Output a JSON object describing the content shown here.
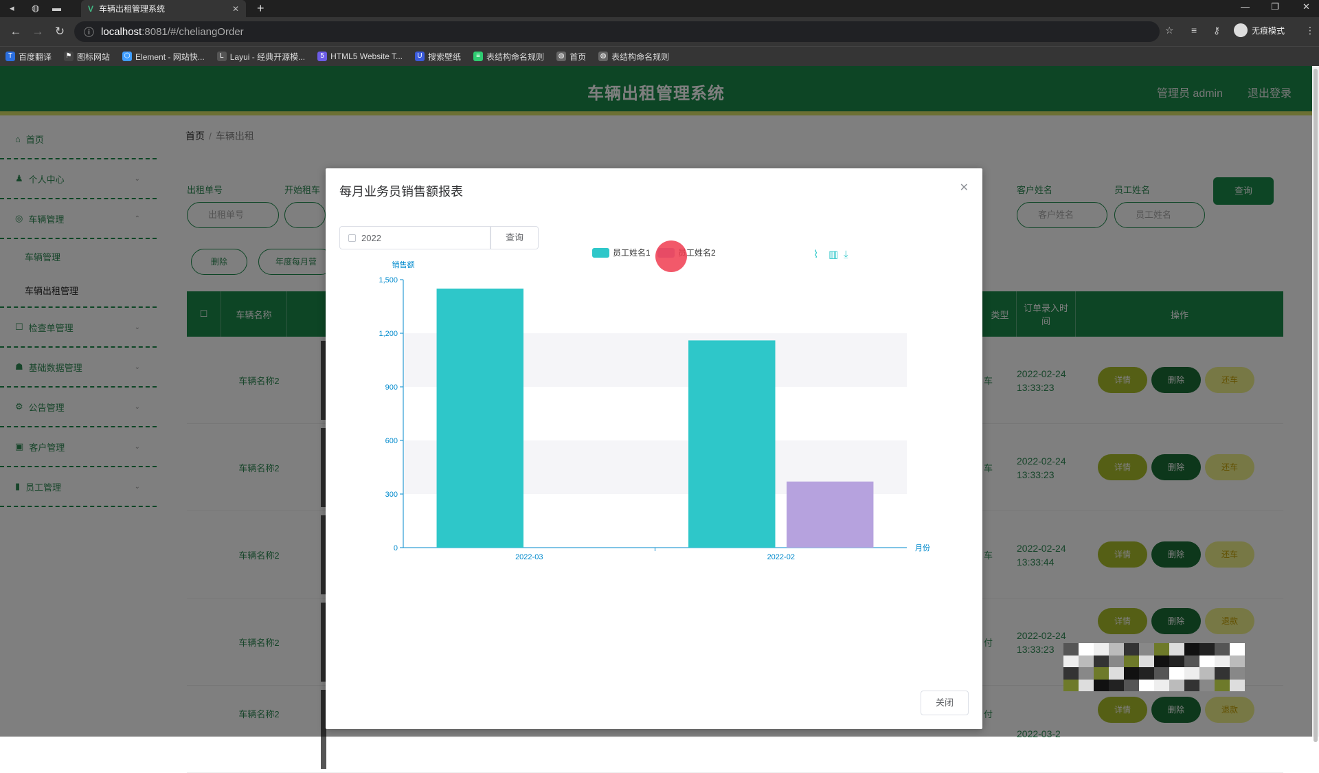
{
  "browser": {
    "tab_title": "车辆出租管理系统",
    "url_host": "localhost",
    "url_path": ":8081/#/cheliangOrder",
    "incognito_label": "无痕模式",
    "bookmarks": [
      "百度翻译",
      "图标网站",
      "Element - 网站快...",
      "Layui - 经典开源模...",
      "HTML5 Website T...",
      "搜索壁纸",
      "表结构命名规则",
      "首页",
      "表结构命名规则"
    ]
  },
  "header": {
    "title": "车辆出租管理系统",
    "user": "管理员 admin",
    "logout": "退出登录"
  },
  "sidebar": {
    "items": [
      {
        "label": "首页"
      },
      {
        "label": "个人中心"
      },
      {
        "label": "车辆管理"
      },
      {
        "label": "车辆管理"
      },
      {
        "label": "车辆出租管理"
      },
      {
        "label": "检查单管理"
      },
      {
        "label": "基础数据管理"
      },
      {
        "label": "公告管理"
      },
      {
        "label": "客户管理"
      },
      {
        "label": "员工管理"
      }
    ]
  },
  "breadcrumb": {
    "home": "首页",
    "sep": "/",
    "current": "车辆出租"
  },
  "filters": {
    "order_no_label": "出租单号",
    "order_no_placeholder": "出租单号",
    "start_label": "开始租车",
    "customer_label": "客户姓名",
    "customer_placeholder": "客户姓名",
    "staff_label": "员工姓名",
    "staff_placeholder": "员工姓名",
    "query_button": "查询"
  },
  "actions": {
    "delete": "删除",
    "report": "年度每月营"
  },
  "table": {
    "headers": {
      "name": "车辆名称",
      "type": "类型",
      "entry_time": "订单录入时间",
      "ops": "操作"
    },
    "rows": [
      {
        "name": "车辆名称2",
        "col": "车",
        "time": "2022-02-24 13:33:23",
        "btn1": "详情",
        "btn2": "删除",
        "btn3": "还车"
      },
      {
        "name": "车辆名称2",
        "col": "车",
        "time": "2022-02-24 13:33:23",
        "btn1": "详情",
        "btn2": "删除",
        "btn3": "还车"
      },
      {
        "name": "车辆名称2",
        "col": "车",
        "time": "2022-02-24 13:33:44",
        "btn1": "详情",
        "btn2": "删除",
        "btn3": "还车"
      },
      {
        "name": "车辆名称2",
        "col": "付",
        "time": "2022-02-24 13:33:23",
        "btn1": "详情",
        "btn2": "删除",
        "btn3": "退款"
      },
      {
        "name": "车辆名称2",
        "col": "付",
        "time": "2022-03-2",
        "btn1": "详情",
        "btn2": "删除",
        "btn3": "退款"
      }
    ]
  },
  "dialog": {
    "title": "每月业务员销售额报表",
    "year_value": "2022",
    "query_button": "查询",
    "close_button": "关闭"
  },
  "chart_data": {
    "type": "bar",
    "categories": [
      "2022-03",
      "2022-02"
    ],
    "series": [
      {
        "name": "员工姓名1",
        "color": "#2ec7c9",
        "values": [
          1450,
          1160
        ]
      },
      {
        "name": "员工姓名2",
        "color": "#b6a2de",
        "values": [
          0,
          370
        ]
      }
    ],
    "xlabel": "月份",
    "ylabel": "销售额",
    "ylim": [
      0,
      1500
    ],
    "yticks": [
      0,
      300,
      600,
      900,
      1200,
      1500
    ],
    "ytick_labels": [
      "0",
      "300",
      "600",
      "900",
      "1,200",
      "1,500"
    ],
    "legend": "top-center",
    "toolbox": [
      "line-chart-icon",
      "bar-chart-icon",
      "download-icon"
    ]
  }
}
